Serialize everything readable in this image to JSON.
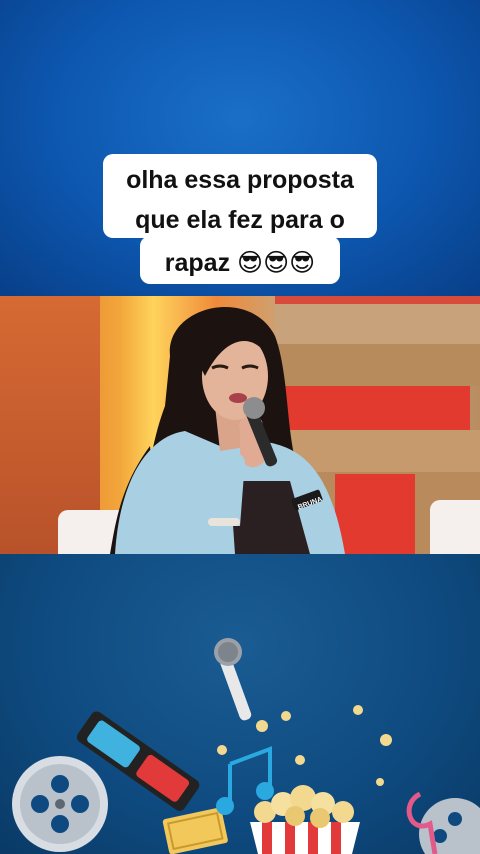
{
  "caption": {
    "line1": "olha essa proposta",
    "line2": "que ela fez para o",
    "line3": "rapaz 😎😎😎"
  },
  "video": {
    "name_tag": "BRUNA"
  },
  "colors": {
    "top_background": "#0d57b0",
    "bottom_background": "#0e4a7f",
    "caption_bg": "#ffffff"
  },
  "decor_icons": [
    "microphone-icon",
    "3d-glasses-icon",
    "film-reel-icon",
    "popcorn-icon",
    "music-note-icon",
    "ticket-icon",
    "clapperboard-icon"
  ]
}
